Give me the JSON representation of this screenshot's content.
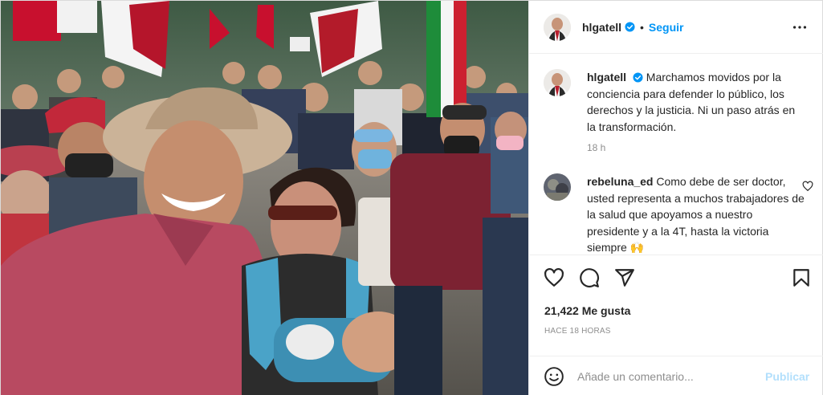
{
  "header": {
    "username": "hlgatell",
    "separator": "•",
    "follow_label": "Seguir",
    "more_icon": "more-horizontal-icon"
  },
  "caption": {
    "username": "hlgatell",
    "text": "Marchamos movidos por la conciencia para defender lo público, los derechos y la justicia. Ni un paso atrás en la transformación.",
    "time": "18 h"
  },
  "comment": {
    "username": "rebeluna_ed",
    "text": "Como debe de ser doctor, usted representa a muchos trabajadores de la salud que apoyamos a nuestro presidente y a la 4T, hasta la victoria siempre"
  },
  "actions": {
    "like_icon": "heart-icon",
    "comment_icon": "comment-icon",
    "share_icon": "share-icon",
    "save_icon": "bookmark-icon"
  },
  "likes_text": "21,422 Me gusta",
  "posted_ago": "HACE 18 HORAS",
  "add_comment": {
    "placeholder": "Añade un comentario...",
    "publish_label": "Publicar",
    "emoji_icon": "emoji-icon"
  },
  "colors": {
    "link_blue": "#0095f6",
    "publish_disabled": "#b2dffc",
    "muted": "#8e8e8e",
    "verified": "#0095f6"
  }
}
